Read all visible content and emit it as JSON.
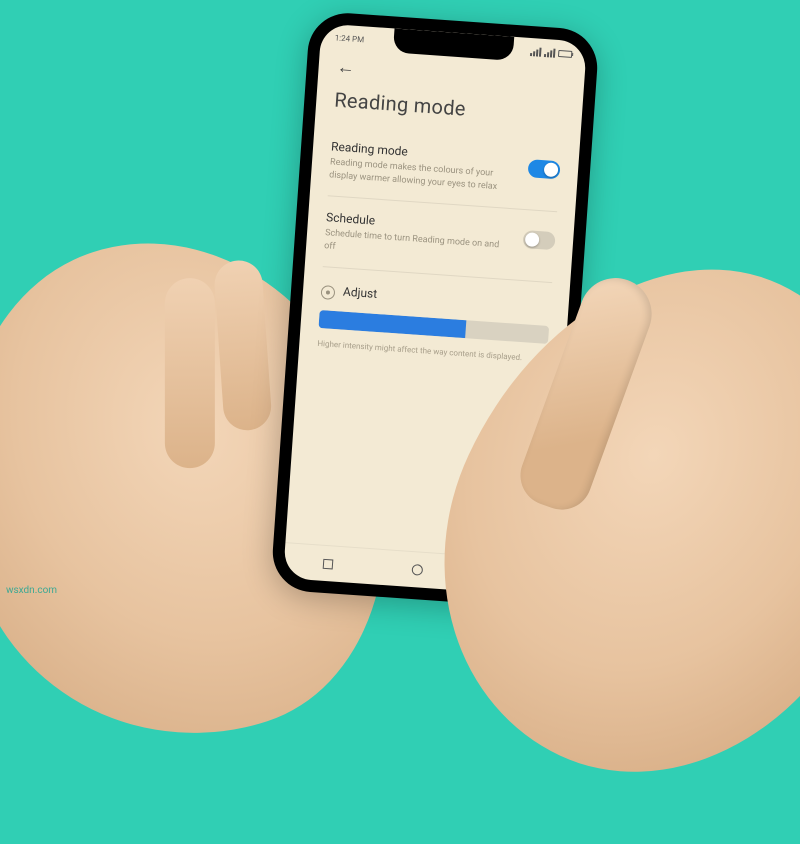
{
  "watermark": "wsxdn.com",
  "status": {
    "time": "1:24 PM"
  },
  "page": {
    "title": "Reading mode"
  },
  "settings": {
    "readingMode": {
      "title": "Reading mode",
      "desc": "Reading mode makes the colours of your display warmer allowing your eyes to relax",
      "enabled": true
    },
    "schedule": {
      "title": "Schedule",
      "desc": "Schedule time to turn Reading mode on and off",
      "enabled": false
    },
    "adjust": {
      "label": "Adjust",
      "value_percent": 64,
      "note": "Higher intensity might affect the way content is displayed."
    }
  },
  "colors": {
    "accent": "#1e88e5",
    "screen_bg": "#f3ead4",
    "page_bg": "#30cfb4"
  }
}
